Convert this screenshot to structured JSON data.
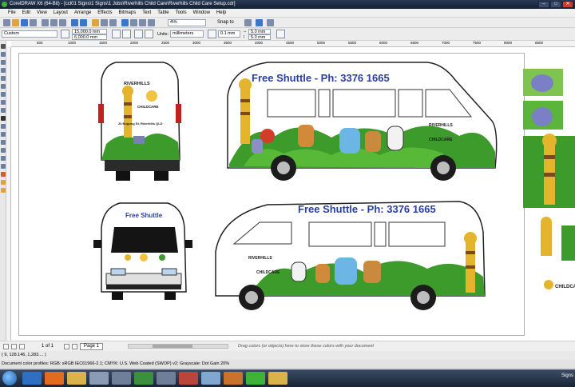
{
  "window": {
    "title": "CorelDRAW X6 (64-Bit) - [ccl01 Signs\\1 Signs\\1 Jobs\\Riverhills Child Care\\Riverhills Child Care Setup.cdr]",
    "min": "–",
    "max": "□",
    "close": "✕"
  },
  "menu": [
    "File",
    "Edit",
    "View",
    "Layout",
    "Arrange",
    "Effects",
    "Bitmaps",
    "Text",
    "Table",
    "Tools",
    "Window",
    "Help"
  ],
  "toolbar": {
    "zoom": "4%",
    "snap_to": "Snap to"
  },
  "property_bar": {
    "preset": "Custom",
    "width": "15,000.0 mm",
    "height": "6,000.0 mm",
    "units_label": "Units:",
    "units": "millimeters",
    "nudge": "0.1 mm",
    "dup_x": "5.0 mm",
    "dup_y": "5.0 mm"
  },
  "ruler": {
    "labels": [
      "500",
      "1000",
      "1500",
      "2000",
      "2500",
      "3000",
      "3500",
      "4000",
      "4500",
      "5000",
      "5500",
      "6000",
      "6500",
      "7000",
      "7500",
      "8000",
      "8500"
    ]
  },
  "artwork": {
    "shuttle_text": "Free Shuttle - Ph: 3376 1665",
    "shuttle_short": "Free Shuttle",
    "brand_top": "RIVERHILLS",
    "brand_bottom": "CHILDCARE",
    "address": "20 Bogong St, Riverhills QLD"
  },
  "pages": {
    "count": "1 of 1",
    "tab": "Page 1",
    "hint": "Drag colors (or objects) here to store these colors with your document"
  },
  "status": {
    "coords": "( 9, 128.146, 1,283.... )",
    "profile": "Document color profiles: RGB: sRGB IEC61966-2.1; CMYK: U.S. Web Coated (SWOP) v2; Grayscale: Dot Gain 20%"
  },
  "taskbar": {
    "clock": "Signs"
  },
  "colors": {
    "shuttle_blue": "#2a3f9e",
    "leaf_green": "#3c9b2a",
    "titlebar": "#1c2a40"
  }
}
